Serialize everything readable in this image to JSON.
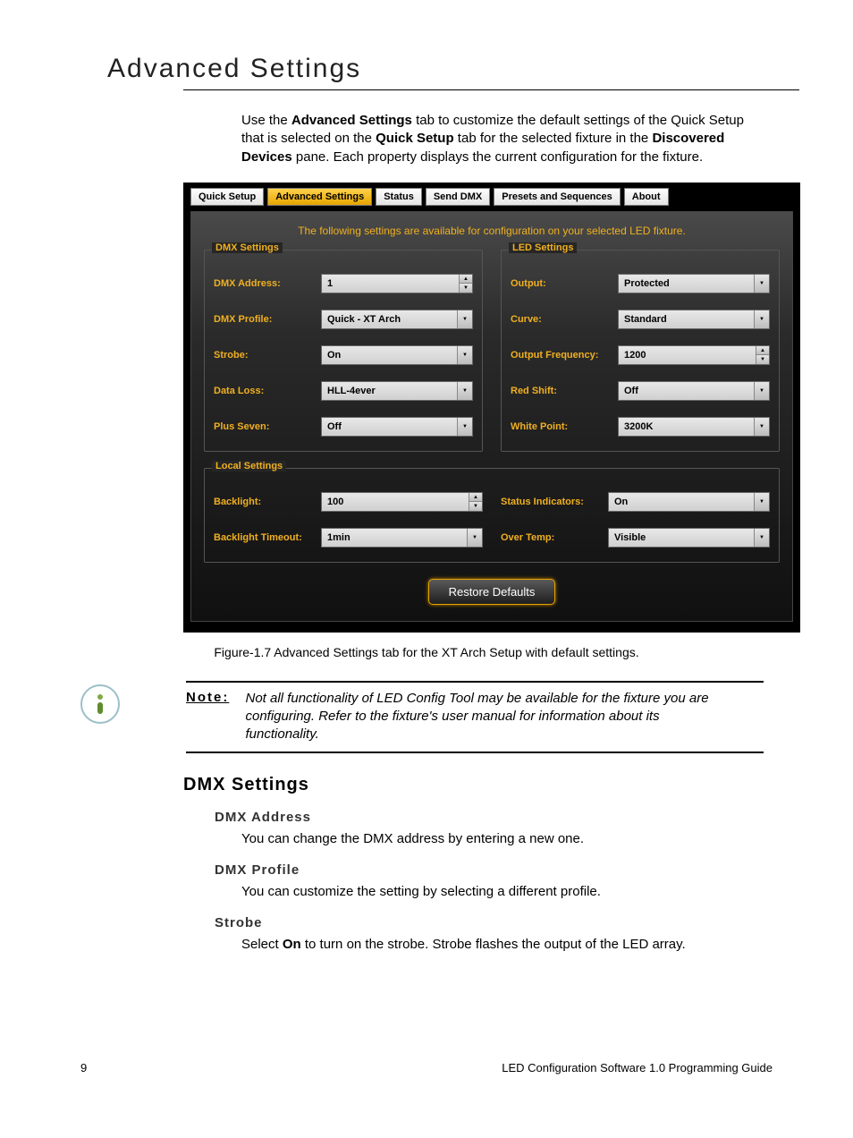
{
  "page": {
    "title": "Advanced Settings",
    "intro_parts": {
      "t1": "Use the ",
      "b1": "Advanced Settings",
      "t2": " tab to customize the default settings of the Quick Setup that is selected on the ",
      "b2": "Quick Setup",
      "t3": " tab for the selected fixture in the ",
      "b3": "Discovered Devices",
      "t4": " pane. Each property displays the current configuration for the fixture."
    },
    "figure_caption": "Figure-1.7 Advanced Settings tab for the XT Arch Setup with default settings.",
    "note_label": "Note:",
    "note_body": "Not all functionality of LED Config Tool may be available for the fixture you are configuring. Refer to the fixture's user manual for information about its functionality.",
    "sections_heading": "DMX Settings",
    "subs": {
      "dmx_address": {
        "h": "DMX Address",
        "p": "You can change the DMX address by entering a new one."
      },
      "dmx_profile": {
        "h": "DMX Profile",
        "p": "You can customize the setting by selecting a different profile."
      },
      "strobe": {
        "h": "Strobe",
        "p_pre": "Select ",
        "p_bold": "On",
        "p_post": " to turn on the strobe. Strobe flashes the output of the LED array."
      }
    },
    "footer_page": "9",
    "footer_title": "LED Configuration Software 1.0 Programming Guide"
  },
  "app": {
    "tabs": [
      "Quick Setup",
      "Advanced Settings",
      "Status",
      "Send DMX",
      "Presets and Sequences",
      "About"
    ],
    "active_tab": "Advanced Settings",
    "caption": "The following settings are available for configuration on your selected LED fixture.",
    "groups": {
      "dmx": {
        "title": "DMX Settings",
        "rows": [
          {
            "label": "DMX Address:",
            "value": "1",
            "control": "spinner"
          },
          {
            "label": "DMX Profile:",
            "value": "Quick - XT Arch",
            "control": "dropdown"
          },
          {
            "label": "Strobe:",
            "value": "On",
            "control": "dropdown"
          },
          {
            "label": "Data Loss:",
            "value": "HLL-4ever",
            "control": "dropdown"
          },
          {
            "label": "Plus Seven:",
            "value": "Off",
            "control": "dropdown"
          }
        ]
      },
      "led": {
        "title": "LED Settings",
        "rows": [
          {
            "label": "Output:",
            "value": "Protected",
            "control": "dropdown"
          },
          {
            "label": "Curve:",
            "value": "Standard",
            "control": "dropdown"
          },
          {
            "label": "Output Frequency:",
            "value": "1200",
            "control": "spinner"
          },
          {
            "label": "Red Shift:",
            "value": "Off",
            "control": "dropdown"
          },
          {
            "label": "White Point:",
            "value": "3200K",
            "control": "dropdown"
          }
        ]
      },
      "local": {
        "title": "Local Settings",
        "left": [
          {
            "label": "Backlight:",
            "value": "100",
            "control": "spinner"
          },
          {
            "label": "Backlight Timeout:",
            "value": "1min",
            "control": "dropdown"
          }
        ],
        "right": [
          {
            "label": "Status Indicators:",
            "value": "On",
            "control": "dropdown"
          },
          {
            "label": "Over Temp:",
            "value": "Visible",
            "control": "dropdown"
          }
        ]
      }
    },
    "restore_label": "Restore Defaults"
  }
}
